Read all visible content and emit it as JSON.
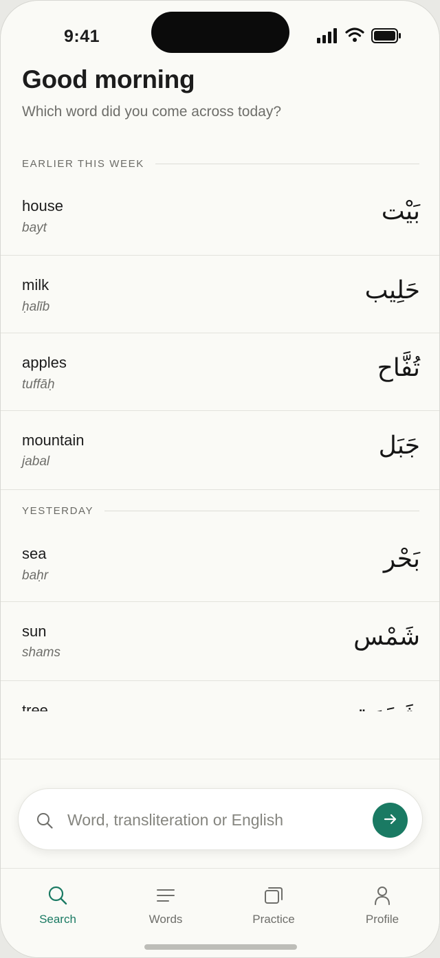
{
  "status": {
    "time": "9:41"
  },
  "header": {
    "greeting": "Good morning",
    "subtitle": "Which word did you come across today?"
  },
  "sections": [
    {
      "title": "EARLIER THIS WEEK",
      "items": [
        {
          "english": "house",
          "translit": "bayt",
          "arabic": "بَيْت"
        },
        {
          "english": "milk",
          "translit": "ḥalīb",
          "arabic": "حَلِيب"
        },
        {
          "english": "apples",
          "translit": "tuffāḥ",
          "arabic": "تُفَّاح"
        },
        {
          "english": "mountain",
          "translit": "jabal",
          "arabic": "جَبَل"
        }
      ]
    },
    {
      "title": "YESTERDAY",
      "items": [
        {
          "english": "sea",
          "translit": "baḥr",
          "arabic": "بَحْر"
        },
        {
          "english": "sun",
          "translit": "shams",
          "arabic": "شَمْس"
        },
        {
          "english": "tree",
          "translit": "",
          "arabic": "شَجَرَة"
        }
      ]
    }
  ],
  "search": {
    "placeholder": "Word, transliteration or English",
    "icon": "search-icon",
    "submit_icon": "arrow-right-icon"
  },
  "tabs": [
    {
      "label": "Search",
      "icon": "search-icon",
      "active": true
    },
    {
      "label": "Words",
      "icon": "list-icon",
      "active": false
    },
    {
      "label": "Practice",
      "icon": "cards-icon",
      "active": false
    },
    {
      "label": "Profile",
      "icon": "person-icon",
      "active": false
    }
  ],
  "colors": {
    "accent": "#1a7a63",
    "background": "#fafaf6",
    "muted_text": "#6e6e6a"
  }
}
